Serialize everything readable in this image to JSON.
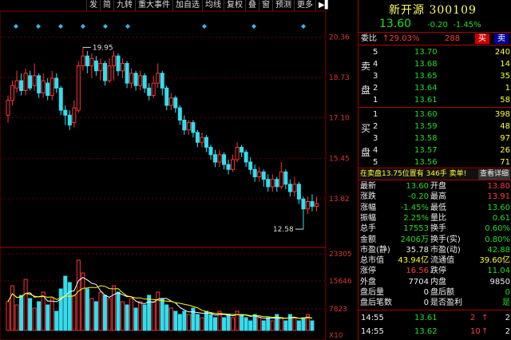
{
  "toolbar": {
    "items": [
      "发",
      "简",
      "九转",
      "重大事件",
      "加自选",
      "均线",
      "复权",
      "叠",
      "窗",
      "预测",
      "更多"
    ],
    "pin_icon": "pin-icon"
  },
  "chart_data": {
    "type": "candlestick",
    "y_ticks": [
      "20.36",
      "18.73",
      "17.10",
      "15.45",
      "13.82"
    ],
    "vol_ticks": [
      "23305",
      "15646",
      "7823",
      "X10"
    ],
    "ylim": [
      12.0,
      20.9
    ],
    "high_label": "19.95",
    "low_label": "12.58",
    "candles": [
      {
        "o": 17.2,
        "c": 17.8,
        "h": 18.0,
        "l": 16.9
      },
      {
        "o": 17.8,
        "c": 18.4,
        "h": 18.6,
        "l": 17.6
      },
      {
        "o": 18.3,
        "c": 18.6,
        "h": 19.0,
        "l": 18.1
      },
      {
        "o": 18.6,
        "c": 18.2,
        "h": 18.9,
        "l": 18.0
      },
      {
        "o": 18.2,
        "c": 18.9,
        "h": 19.1,
        "l": 18.0
      },
      {
        "o": 18.8,
        "c": 18.3,
        "h": 19.0,
        "l": 18.2
      },
      {
        "o": 18.4,
        "c": 18.8,
        "h": 19.3,
        "l": 18.2
      },
      {
        "o": 18.8,
        "c": 18.1,
        "h": 18.9,
        "l": 17.9
      },
      {
        "o": 18.1,
        "c": 18.6,
        "h": 18.9,
        "l": 17.9
      },
      {
        "o": 18.5,
        "c": 18.0,
        "h": 18.7,
        "l": 17.8
      },
      {
        "o": 18.0,
        "c": 18.7,
        "h": 19.0,
        "l": 17.8
      },
      {
        "o": 18.7,
        "c": 18.3,
        "h": 18.9,
        "l": 18.1
      },
      {
        "o": 18.3,
        "c": 17.4,
        "h": 18.4,
        "l": 17.2
      },
      {
        "o": 17.4,
        "c": 17.2,
        "h": 17.6,
        "l": 16.8
      },
      {
        "o": 17.2,
        "c": 16.8,
        "h": 17.4,
        "l": 16.6
      },
      {
        "o": 16.9,
        "c": 17.5,
        "h": 17.8,
        "l": 16.7
      },
      {
        "o": 17.4,
        "c": 19.2,
        "h": 19.4,
        "l": 17.3
      },
      {
        "o": 19.2,
        "c": 19.6,
        "h": 19.95,
        "l": 19.0
      },
      {
        "o": 19.6,
        "c": 19.2,
        "h": 19.8,
        "l": 18.9
      },
      {
        "o": 19.2,
        "c": 19.5,
        "h": 19.7,
        "l": 18.7
      },
      {
        "o": 19.4,
        "c": 19.0,
        "h": 19.6,
        "l": 18.8
      },
      {
        "o": 19.0,
        "c": 19.3,
        "h": 19.5,
        "l": 18.6
      },
      {
        "o": 19.3,
        "c": 18.6,
        "h": 19.4,
        "l": 18.4
      },
      {
        "o": 18.6,
        "c": 19.2,
        "h": 19.5,
        "l": 18.5
      },
      {
        "o": 19.2,
        "c": 19.6,
        "h": 19.8,
        "l": 18.6
      },
      {
        "o": 19.6,
        "c": 19.0,
        "h": 19.7,
        "l": 18.8
      },
      {
        "o": 19.0,
        "c": 19.3,
        "h": 19.5,
        "l": 18.7
      },
      {
        "o": 19.3,
        "c": 18.5,
        "h": 19.4,
        "l": 18.3
      },
      {
        "o": 18.5,
        "c": 18.9,
        "h": 19.1,
        "l": 18.3
      },
      {
        "o": 18.9,
        "c": 18.4,
        "h": 19.0,
        "l": 18.2
      },
      {
        "o": 18.4,
        "c": 18.8,
        "h": 19.0,
        "l": 18.2
      },
      {
        "o": 18.8,
        "c": 18.3,
        "h": 18.9,
        "l": 18.1
      },
      {
        "o": 18.3,
        "c": 18.0,
        "h": 18.5,
        "l": 17.8
      },
      {
        "o": 18.0,
        "c": 18.5,
        "h": 18.8,
        "l": 17.9
      },
      {
        "o": 18.5,
        "c": 18.9,
        "h": 19.3,
        "l": 18.3
      },
      {
        "o": 18.9,
        "c": 18.3,
        "h": 19.0,
        "l": 18.0
      },
      {
        "o": 18.3,
        "c": 17.6,
        "h": 18.4,
        "l": 17.4
      },
      {
        "o": 17.6,
        "c": 17.9,
        "h": 18.1,
        "l": 17.4
      },
      {
        "o": 17.9,
        "c": 17.5,
        "h": 18.0,
        "l": 17.3
      },
      {
        "o": 17.5,
        "c": 17.0,
        "h": 17.6,
        "l": 16.8
      },
      {
        "o": 17.0,
        "c": 16.6,
        "h": 17.2,
        "l": 16.4
      },
      {
        "o": 16.6,
        "c": 16.9,
        "h": 17.0,
        "l": 16.4
      },
      {
        "o": 16.9,
        "c": 16.5,
        "h": 17.0,
        "l": 16.3
      },
      {
        "o": 16.5,
        "c": 16.1,
        "h": 16.6,
        "l": 15.9
      },
      {
        "o": 16.1,
        "c": 16.3,
        "h": 16.5,
        "l": 15.9
      },
      {
        "o": 16.3,
        "c": 15.9,
        "h": 16.4,
        "l": 15.7
      },
      {
        "o": 15.9,
        "c": 15.6,
        "h": 16.0,
        "l": 15.4
      },
      {
        "o": 15.6,
        "c": 15.3,
        "h": 15.8,
        "l": 15.1
      },
      {
        "o": 15.3,
        "c": 15.6,
        "h": 15.8,
        "l": 15.1
      },
      {
        "o": 15.6,
        "c": 15.2,
        "h": 15.7,
        "l": 15.0
      },
      {
        "o": 15.2,
        "c": 15.0,
        "h": 15.4,
        "l": 14.8
      },
      {
        "o": 15.0,
        "c": 15.4,
        "h": 15.6,
        "l": 14.9
      },
      {
        "o": 15.4,
        "c": 15.9,
        "h": 16.1,
        "l": 15.3
      },
      {
        "o": 15.9,
        "c": 15.7,
        "h": 16.0,
        "l": 15.5
      },
      {
        "o": 15.7,
        "c": 15.3,
        "h": 15.8,
        "l": 15.1
      },
      {
        "o": 15.3,
        "c": 15.0,
        "h": 15.5,
        "l": 14.8
      },
      {
        "o": 15.0,
        "c": 14.7,
        "h": 15.2,
        "l": 14.5
      },
      {
        "o": 14.7,
        "c": 14.9,
        "h": 15.1,
        "l": 14.5
      },
      {
        "o": 14.9,
        "c": 14.6,
        "h": 15.0,
        "l": 14.3
      },
      {
        "o": 14.6,
        "c": 14.3,
        "h": 14.8,
        "l": 14.1
      },
      {
        "o": 14.3,
        "c": 14.6,
        "h": 14.8,
        "l": 14.1
      },
      {
        "o": 14.6,
        "c": 14.3,
        "h": 14.7,
        "l": 14.1
      },
      {
        "o": 14.3,
        "c": 14.9,
        "h": 15.3,
        "l": 14.2
      },
      {
        "o": 14.9,
        "c": 14.4,
        "h": 15.0,
        "l": 14.2
      },
      {
        "o": 14.4,
        "c": 14.1,
        "h": 14.6,
        "l": 13.9
      },
      {
        "o": 14.1,
        "c": 14.4,
        "h": 14.7,
        "l": 13.9
      },
      {
        "o": 14.4,
        "c": 13.8,
        "h": 14.5,
        "l": 13.6
      },
      {
        "o": 13.8,
        "c": 13.4,
        "h": 13.9,
        "l": 12.58
      },
      {
        "o": 13.4,
        "c": 13.7,
        "h": 13.9,
        "l": 13.2
      },
      {
        "o": 13.7,
        "c": 13.5,
        "h": 14.0,
        "l": 13.3
      },
      {
        "o": 13.5,
        "c": 13.6,
        "h": 13.9,
        "l": 13.3
      }
    ],
    "volumes": [
      9,
      14,
      8,
      11,
      16,
      10,
      7,
      9,
      12,
      8,
      10,
      6,
      13,
      17,
      15,
      11,
      22,
      18,
      13,
      10,
      9,
      12,
      11,
      10,
      14,
      12,
      9,
      8,
      10,
      7,
      9,
      8,
      11,
      9,
      12,
      10,
      8,
      7,
      6,
      5,
      6,
      5,
      7,
      5,
      4,
      6,
      5,
      4,
      6,
      4,
      5,
      4,
      6,
      5,
      4,
      3,
      5,
      4,
      3,
      4,
      3,
      5,
      4,
      3,
      5,
      4,
      3,
      4,
      5,
      3
    ]
  },
  "panel": {
    "name": "新开源",
    "code": "300109",
    "price": "13.60",
    "change": "-0.20",
    "pct": "-1.45%",
    "weibi_label": "委比",
    "weibi_value": "↑29.03%",
    "weibi_diff": "288",
    "buy_btn": "买",
    "sell_btn": "卖",
    "sell_side_label": [
      "卖",
      "盘"
    ],
    "buy_side_label": [
      "买",
      "盘"
    ],
    "sells": [
      {
        "lvl": "5",
        "p": "13.70",
        "v": "240"
      },
      {
        "lvl": "4",
        "p": "13.68",
        "v": "14"
      },
      {
        "lvl": "3",
        "p": "13.65",
        "v": "35"
      },
      {
        "lvl": "2",
        "p": "13.64",
        "v": "1"
      },
      {
        "lvl": "1",
        "p": "13.61",
        "v": "58"
      }
    ],
    "buys": [
      {
        "lvl": "1",
        "p": "13.60",
        "v": "398"
      },
      {
        "lvl": "2",
        "p": "13.59",
        "v": "48"
      },
      {
        "lvl": "3",
        "p": "13.58",
        "v": "97"
      },
      {
        "lvl": "4",
        "p": "13.57",
        "v": "26"
      },
      {
        "lvl": "5",
        "p": "13.56",
        "v": "71"
      }
    ],
    "notice": "在卖盘13.75位置有 346手 卖单!",
    "notice_link": "查看详细",
    "stats": [
      [
        "最新",
        "13.60",
        "开盘",
        "13.80"
      ],
      [
        "涨跌",
        "-0.20",
        "最高",
        "13.91"
      ],
      [
        "涨幅",
        "-1.45%",
        "最低",
        "13.60"
      ],
      [
        "振幅",
        "2.25%",
        "量比",
        "0.61"
      ],
      [
        "总手",
        "17553",
        "换手",
        "0.60%"
      ],
      [
        "金额",
        "2406万",
        "换手(实)",
        "0.80%"
      ],
      [
        "市盈(静)",
        "35.78",
        "市盈(动)",
        "42.88"
      ],
      [
        "总市值",
        "43.94亿",
        "流通值",
        "39.60亿"
      ],
      [
        "涨停",
        "16.56",
        "跌停",
        "11.04"
      ],
      [
        "外盘",
        "7704",
        "内盘",
        "9850"
      ],
      [
        "盘后量",
        "0",
        "盘后额",
        "0"
      ],
      [
        "盘后笔数",
        "0",
        "是否盈利",
        "是"
      ]
    ],
    "ticks": [
      {
        "time": "14:55",
        "price": "13.61",
        "vol": "2",
        "dir": "↑"
      },
      {
        "time": "14:55",
        "price": "13.62",
        "vol": "10",
        "dir": "↑"
      }
    ],
    "tick_flag": "2"
  }
}
